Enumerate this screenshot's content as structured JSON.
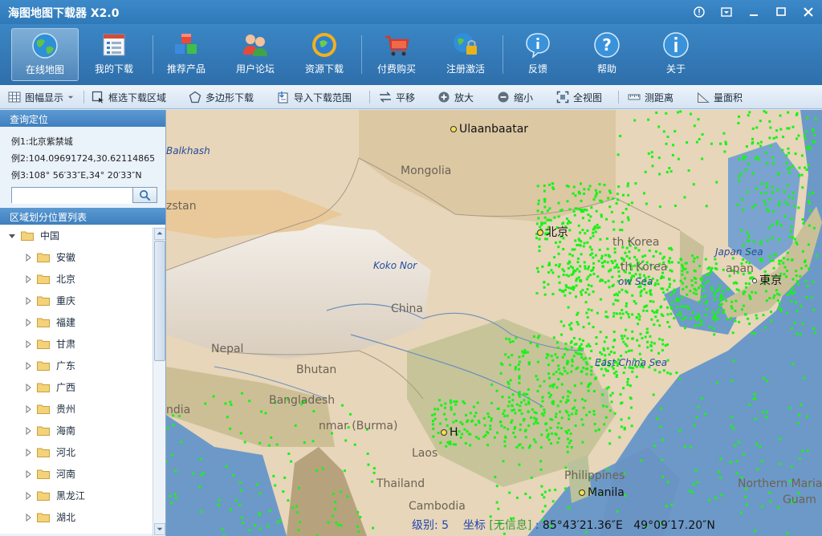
{
  "window": {
    "title": "海图地图下载器 X2.0",
    "controls": [
      "info-icon",
      "dropdown-icon",
      "minimize-icon",
      "maximize-icon",
      "close-icon"
    ]
  },
  "main_toolbar": {
    "buttons": [
      {
        "label": "在线地图",
        "icon": "globe-icon",
        "active": true
      },
      {
        "label": "我的下载",
        "icon": "download-list-icon"
      },
      {
        "label": "推荐产品",
        "icon": "cubes-icon"
      },
      {
        "label": "用户论坛",
        "icon": "users-icon"
      },
      {
        "label": "资源下载",
        "icon": "resource-globe-icon"
      },
      {
        "label": "付费购买",
        "icon": "cart-icon"
      },
      {
        "label": "注册激活",
        "icon": "lock-globe-icon"
      },
      {
        "label": "反馈",
        "icon": "feedback-icon"
      },
      {
        "label": "帮助",
        "icon": "help-icon"
      },
      {
        "label": "关于",
        "icon": "about-icon"
      }
    ]
  },
  "sub_toolbar": {
    "items": [
      {
        "label": "图幅显示",
        "icon": "grid-icon"
      },
      {
        "label": "框选下载区域",
        "icon": "select-rect-icon"
      },
      {
        "label": "多边形下载",
        "icon": "polygon-icon"
      },
      {
        "label": "导入下载范围",
        "icon": "import-icon"
      },
      {
        "label": "平移",
        "icon": "pan-icon"
      },
      {
        "label": "放大",
        "icon": "zoom-in-icon"
      },
      {
        "label": "缩小",
        "icon": "zoom-out-icon"
      },
      {
        "label": "全视图",
        "icon": "full-extent-icon"
      },
      {
        "label": "测距离",
        "icon": "ruler-icon"
      },
      {
        "label": "量面积",
        "icon": "area-icon"
      }
    ]
  },
  "query_panel": {
    "title": "查询定位",
    "examples": [
      "例1:北京紫禁城",
      "例2:104.09691724,30.62114865",
      "例3:108° 56′33″E,34° 20′33″N"
    ],
    "search_value": "",
    "search_placeholder": ""
  },
  "region_panel": {
    "title": "区域划分位置列表",
    "root": "中国",
    "provinces": [
      "安徽",
      "北京",
      "重庆",
      "福建",
      "甘肃",
      "广东",
      "广西",
      "贵州",
      "海南",
      "河北",
      "河南",
      "黑龙江",
      "湖北"
    ]
  },
  "map": {
    "labels": {
      "ulaanbaatar": "Ulaanbaatar",
      "balkhash": "Balkhash",
      "mongolia": "Mongolia",
      "kazakhstan_partial": "zstan",
      "beijing": "北京",
      "north_korea": "th Korea",
      "south_korea": "th Korea",
      "japan_sea": "Japan Sea",
      "japan": "apan",
      "tokyo": "東京",
      "koko_nor": "Koko Nor",
      "china": "China",
      "yellow_sea": "ow Sea",
      "nepal": "Nepal",
      "bhutan": "Bhutan",
      "east_china_sea": "East China Sea",
      "bangladesh": "Bangladesh",
      "india_partial": "ndia",
      "myanmar": "nmar (Burma)",
      "laos": "Laos",
      "thailand": "Thailand",
      "cambodia": "Cambodia",
      "philippines": "Philippines",
      "manila": "Manila",
      "northern_mariana": "Northern Maria",
      "guam": "Guam",
      "hanoi_partial": "H"
    },
    "status": {
      "level_label": "级别:",
      "level_value": "5",
      "coord_label": "坐标",
      "no_info": "[无信息]",
      "separator": ":",
      "longitude": "85°43′21.36″E",
      "latitude": "49°09′17.20″N"
    },
    "colors": {
      "accent": "#2f79b8",
      "ship_points": "#19f219",
      "ocean": "#6d99c8",
      "land": "#e7d6b9"
    }
  }
}
